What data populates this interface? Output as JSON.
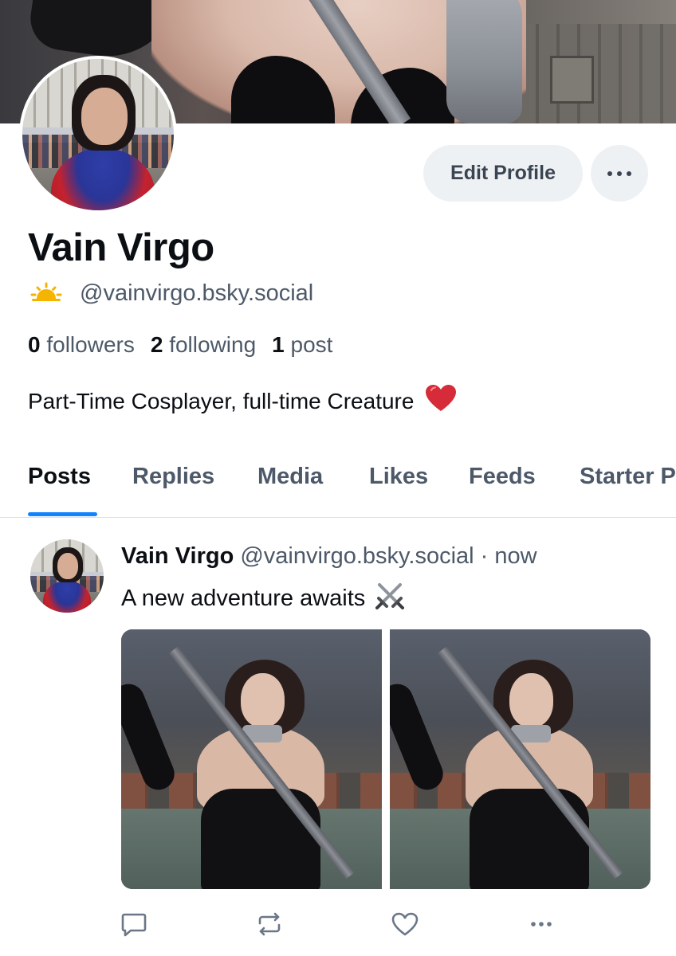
{
  "profile": {
    "display_name": "Vain Virgo",
    "handle": "@vainvirgo.bsky.social",
    "handle_emoji": "sun-behind-cloud-icon",
    "edit_button": "Edit Profile",
    "stats": {
      "followers_count": "0",
      "followers_label": "followers",
      "following_count": "2",
      "following_label": "following",
      "posts_count": "1",
      "posts_label": "post"
    },
    "bio": "Part-Time Cosplayer, full-time Creature"
  },
  "tabs": [
    {
      "label": "Posts",
      "active": true
    },
    {
      "label": "Replies"
    },
    {
      "label": "Media"
    },
    {
      "label": "Likes"
    },
    {
      "label": "Feeds"
    },
    {
      "label": "Starter P"
    }
  ],
  "post": {
    "author_name": "Vain Virgo",
    "author_handle": "@vainvirgo.bsky.social",
    "separator": "·",
    "time": "now",
    "text": "A new adventure awaits",
    "text_emoji": "crossed-swords-icon",
    "media_count": 2
  },
  "colors": {
    "accent": "#1083fe",
    "text_primary": "#0b0f14",
    "text_secondary": "#4d5969",
    "button_bg": "#eef1f4",
    "heart": "#d62c3a"
  }
}
